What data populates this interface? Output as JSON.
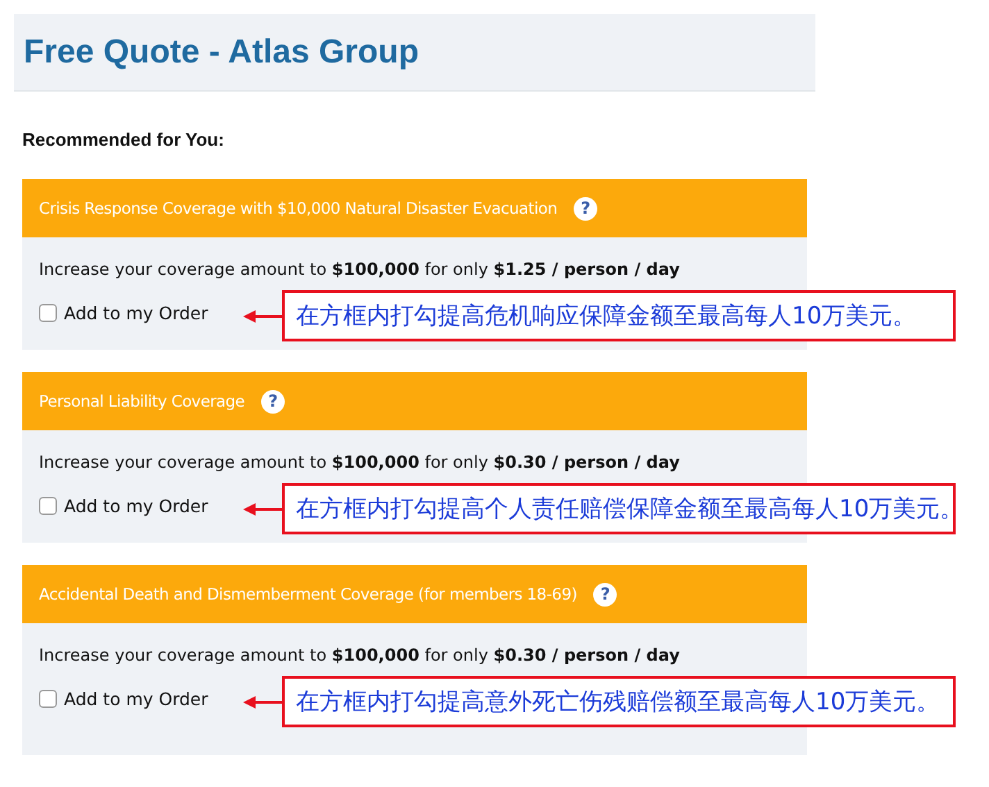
{
  "header": {
    "title": "Free Quote - Atlas Group"
  },
  "subheading": "Recommended for You:",
  "sections": [
    {
      "title": "Crisis Response Coverage with $10,000 Natural Disaster Evacuation",
      "help_icon": "?",
      "description": "Increase your coverage amount to **$100,000** for only **$1.25 / person / day**",
      "checkbox": {
        "label": "Add to my Order",
        "checked": false
      },
      "annotation": "在方框内打勾提高危机响应保障金额至最高每人10万美元。"
    },
    {
      "title": "Personal Liability Coverage",
      "help_icon": "?",
      "description": "Increase your coverage amount to **$100,000** for only **$0.30 / person / day**",
      "checkbox": {
        "label": "Add to my Order",
        "checked": false
      },
      "annotation": "在方框内打勾提高个人责任赔偿保障金额至最高每人10万美元。"
    },
    {
      "title": "Accidental Death and Dismemberment Coverage (for members 18-69)",
      "help_icon": "?",
      "description": "Increase your coverage amount to **$100,000** for only **$0.30 / person / day**",
      "checkbox": {
        "label": "Add to my Order",
        "checked": false
      },
      "annotation": "在方框内打勾提高意外死亡伤残赔偿额至最高每人10万美元。"
    }
  ]
}
